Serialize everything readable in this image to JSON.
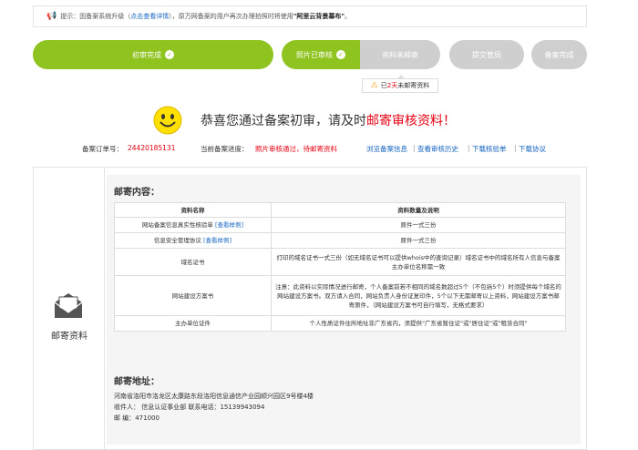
{
  "notice": {
    "prefix": "提示：因备案系统升级（",
    "link": "点击查看详情",
    "middle": "），原万网备案的用户再次办理拍照时将使用",
    "bold": "\"阿里云背景幕布\"",
    "suffix": "。"
  },
  "steps": [
    {
      "label": "初审完成"
    },
    {
      "label": "照片已审核"
    },
    {
      "label": "资料未邮寄"
    },
    {
      "label": "提交管局"
    },
    {
      "label": "备案完成"
    }
  ],
  "mail_badge": {
    "prefix": "已",
    "days": "2天",
    "suffix": "未邮寄资料"
  },
  "congrats": {
    "main": "恭喜您通过备案初审，请及时",
    "highlight": "邮寄审核资料！"
  },
  "info": {
    "order_label": "备案订单号：",
    "order_no": "24420185131",
    "progress_label": "当前备案进度：",
    "progress_value": "照片审核通过，待邮寄资料",
    "links": [
      "浏览备案信息",
      "查看审核历史",
      "下载核验单",
      "下载协议"
    ]
  },
  "left_label": "邮寄资料",
  "section_content_title": "邮寄内容：",
  "table": {
    "headers": [
      "资料名称",
      "资料数量及说明"
    ],
    "rows": [
      {
        "name": "网站备案信息真实性核验单",
        "link": "[查看样例]",
        "desc": "原件一式三份"
      },
      {
        "name": "信息安全管理协议",
        "link": "[查看样例]",
        "desc": "原件一式三份"
      },
      {
        "name": "域名证书",
        "link": "",
        "desc": "打印的域名证书一式三份（如无域名证书可以提供whois中的查询记录）域名证书中的域名所有人信息与备案主办单位名称需一致"
      },
      {
        "name": "网站建设方案书",
        "link": "",
        "desc": "注意：此资料以实际情况进行邮寄，个人备案前若不相同的域名数超过5个（不包括5个）时须提供每个域名的网站建设方案书。双方请入合同，网站负责人身份证复印件，5个以下无需邮寄以上资料，网站建设方案书邮寄原件，（网站建设方案书可自行填写，无格式要求）"
      },
      {
        "name": "主办单位证件",
        "link": "",
        "desc": "个人性质证件住所地址非广东省内，须提供\"广东省暂住证\"或\"居住证\"或\"租赁合同\""
      }
    ]
  },
  "section_address_title": "邮寄地址：",
  "address": {
    "line1": "河南省洛阳市洛龙区太康路东段洛阳信息通信产业园顺兴园区9号楼4楼",
    "line2": "收件人：  信息认证事业部 联系电话：15139943094",
    "line3": "邮  编：471000"
  },
  "colors": {
    "green": "#8fc31f",
    "gray": "#cfcfcf",
    "red": "#e60012",
    "link": "#1565c0"
  }
}
